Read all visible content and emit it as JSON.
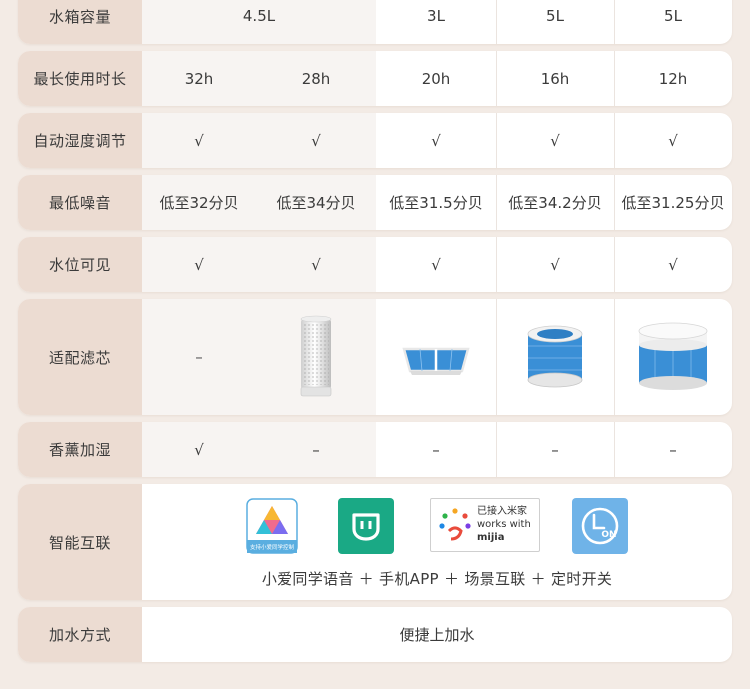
{
  "rows": {
    "tank": {
      "label": "水箱容量",
      "c12": "4.5L",
      "c3": "3L",
      "c4": "5L",
      "c5": "5L"
    },
    "runtime": {
      "label": "最长使用时长",
      "values": [
        "32h",
        "28h",
        "20h",
        "16h",
        "12h"
      ]
    },
    "auto_humidity": {
      "label": "自动湿度调节",
      "values": [
        "√",
        "√",
        "√",
        "√",
        "√"
      ]
    },
    "noise": {
      "label": "最低噪音",
      "values": [
        "低至32分贝",
        "低至34分贝",
        "低至31.5分贝",
        "低至34.2分贝",
        "低至31.25分贝"
      ]
    },
    "water_level": {
      "label": "水位可见",
      "values": [
        "√",
        "√",
        "√",
        "√",
        "√"
      ]
    },
    "filter": {
      "label": "适配滤芯",
      "c1": "–"
    },
    "aroma": {
      "label": "香薰加湿",
      "values": [
        "√",
        "–",
        "–",
        "–",
        "–"
      ]
    },
    "smart": {
      "label": "智能互联",
      "caption": "小爱同学语音 ＋ 手机APP ＋ 场景互联 ＋ 定时开关",
      "xiaoai_badge": "支持小爱同学控制",
      "mijia_line1": "已接入米家",
      "mijia_line2": "works with",
      "mijia_line3": "mijia",
      "timer_badge": "ON"
    },
    "refill": {
      "label": "加水方式",
      "value": "便捷上加水"
    }
  },
  "icons": {
    "xiaoai": "xiaoai-assistant-icon",
    "mihome": "mi-home-app-icon",
    "mijia": "works-with-mijia-icon",
    "timer": "timer-on-icon"
  },
  "colors": {
    "label_bg": "#ecdcd2",
    "page_bg": "#f3ebe5",
    "mihome_green": "#1aa985",
    "timer_blue": "#6fb3e8",
    "filter_blue": "#3a8fd6"
  }
}
